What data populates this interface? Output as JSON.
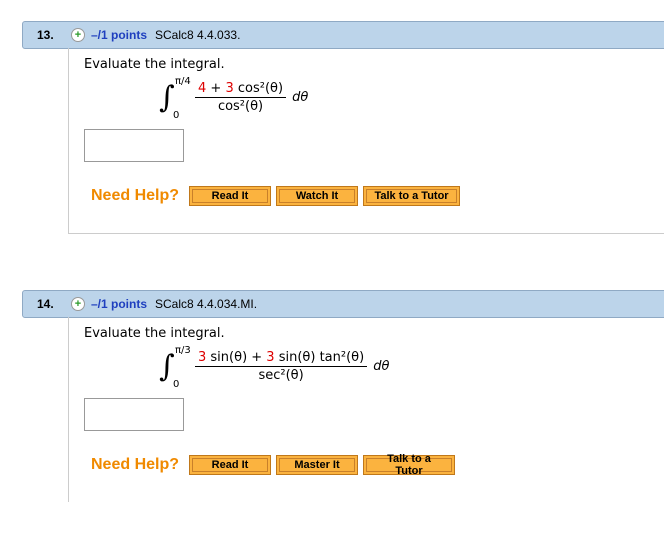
{
  "questions": [
    {
      "number": "13.",
      "points": "–/1 points",
      "ref": "SCalc8 4.4.033.",
      "prompt": "Evaluate the integral.",
      "upper": "π/4",
      "lower": "0",
      "num_a": "4",
      "num_b": " + ",
      "num_c": "3",
      "num_d": " cos²(θ)",
      "den": "cos²(θ)",
      "dtheta": "dθ",
      "need_help": "Need Help?",
      "buttons": [
        "Read It",
        "Watch It",
        "Talk to a Tutor"
      ]
    },
    {
      "number": "14.",
      "points": "–/1 points",
      "ref": "SCalc8 4.4.034.MI.",
      "prompt": "Evaluate the integral.",
      "upper": "π/3",
      "lower": "0",
      "num_a": "3",
      "num_b": " sin(θ) + ",
      "num_c": "3",
      "num_d": " sin(θ) tan²(θ)",
      "den": "sec²(θ)",
      "dtheta": "dθ",
      "need_help": "Need Help?",
      "buttons": [
        "Read It",
        "Master It",
        "Talk to a Tutor"
      ]
    }
  ],
  "plus_icon": "+"
}
